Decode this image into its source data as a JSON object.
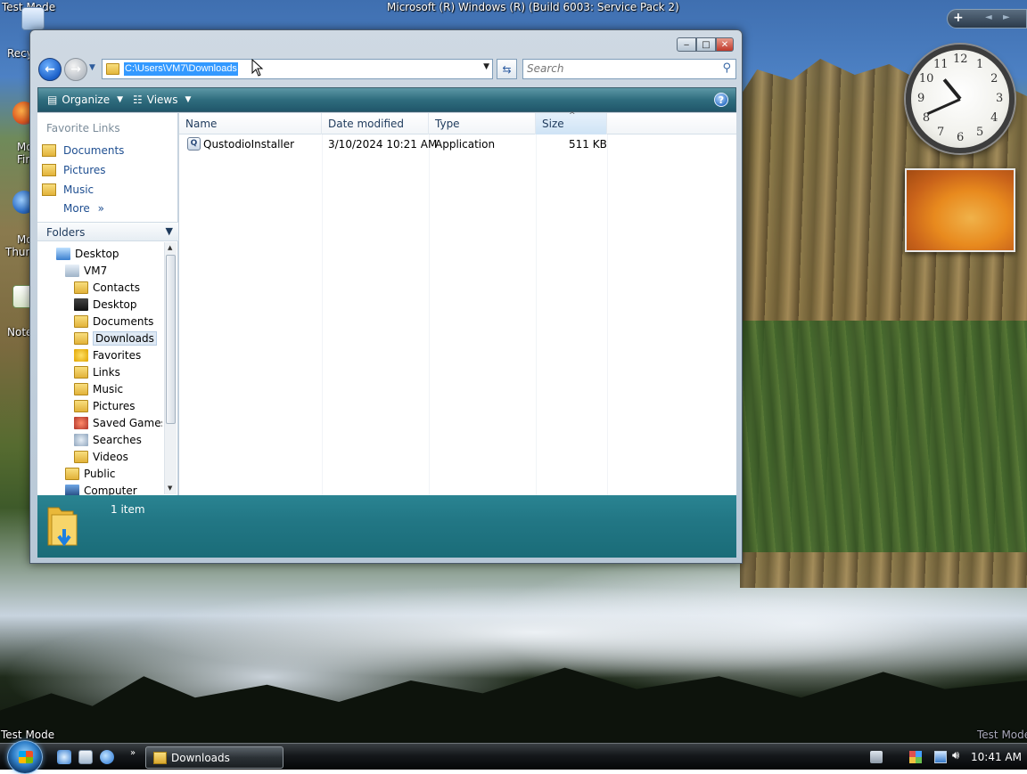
{
  "desktop": {
    "build_text": "Microsoft (R) Windows (R) (Build 6003: Service Pack 2)",
    "test_mode_tl": "Test Mode",
    "test_mode_bl": "Test Mode",
    "test_mode_br": "Test Mode",
    "icons": [
      {
        "label": "Recy",
        "icon": "recycle-bin-icon"
      },
      {
        "label": "Mo",
        "label2": "Fir",
        "icon": "firefox-shortcut-icon"
      },
      {
        "label": "Mo",
        "label2": "Thun",
        "icon": "thunderbird-shortcut-icon"
      },
      {
        "label": "Note",
        "icon": "notepad-shortcut-icon"
      }
    ]
  },
  "gadgets": {
    "add_label": "+",
    "prev_label": "◄",
    "next_label": "►",
    "clock_numbers": [
      "12",
      "1",
      "2",
      "3",
      "4",
      "5",
      "6",
      "7",
      "8",
      "9",
      "10",
      "11"
    ],
    "clock_time": {
      "hour": 10,
      "minute": 41
    }
  },
  "window": {
    "title": "Downloads",
    "controls": {
      "minimize": "‒",
      "maximize": "□",
      "close": "✕"
    },
    "address": "C:\\Users\\VM7\\Downloads",
    "search_placeholder": "Search",
    "command_bar": {
      "organize": "Organize",
      "views": "Views",
      "help": "?"
    },
    "nav_pane": {
      "favorite_links_header": "Favorite Links",
      "favorites": [
        {
          "label": "Documents",
          "icon": "documents-folder-icon"
        },
        {
          "label": "Pictures",
          "icon": "pictures-folder-icon"
        },
        {
          "label": "Music",
          "icon": "music-folder-icon"
        }
      ],
      "more": "More",
      "folders_header": "Folders",
      "tree": [
        {
          "label": "Desktop",
          "level": 1,
          "icon": "desktop-icon"
        },
        {
          "label": "VM7",
          "level": 2,
          "icon": "user-folder-icon"
        },
        {
          "label": "Contacts",
          "level": 3,
          "icon": "contacts-folder-icon"
        },
        {
          "label": "Desktop",
          "level": 3,
          "icon": "desktop-folder-icon"
        },
        {
          "label": "Documents",
          "level": 3,
          "icon": "documents-folder-icon"
        },
        {
          "label": "Downloads",
          "level": 3,
          "icon": "downloads-folder-icon",
          "selected": true
        },
        {
          "label": "Favorites",
          "level": 3,
          "icon": "favorites-star-icon"
        },
        {
          "label": "Links",
          "level": 3,
          "icon": "links-folder-icon"
        },
        {
          "label": "Music",
          "level": 3,
          "icon": "music-folder-icon"
        },
        {
          "label": "Pictures",
          "level": 3,
          "icon": "pictures-folder-icon"
        },
        {
          "label": "Saved Games",
          "level": 3,
          "icon": "saved-games-icon"
        },
        {
          "label": "Searches",
          "level": 3,
          "icon": "searches-icon"
        },
        {
          "label": "Videos",
          "level": 3,
          "icon": "videos-folder-icon"
        },
        {
          "label": "Public",
          "level": 2,
          "icon": "public-folder-icon"
        },
        {
          "label": "Computer",
          "level": 2,
          "icon": "computer-icon"
        }
      ]
    },
    "columns": {
      "name": "Name",
      "date_modified": "Date modified",
      "type": "Type",
      "size": "Size"
    },
    "files": [
      {
        "name": "QustodioInstaller",
        "date_modified": "3/10/2024 10:21 AM",
        "type": "Application",
        "size": "511 KB",
        "icon": "application-icon"
      }
    ],
    "details": {
      "item_count": "1 item"
    }
  },
  "taskbar": {
    "buttons": [
      {
        "label": "Downloads",
        "icon": "folder-icon"
      }
    ],
    "clock": "10:41 AM"
  }
}
